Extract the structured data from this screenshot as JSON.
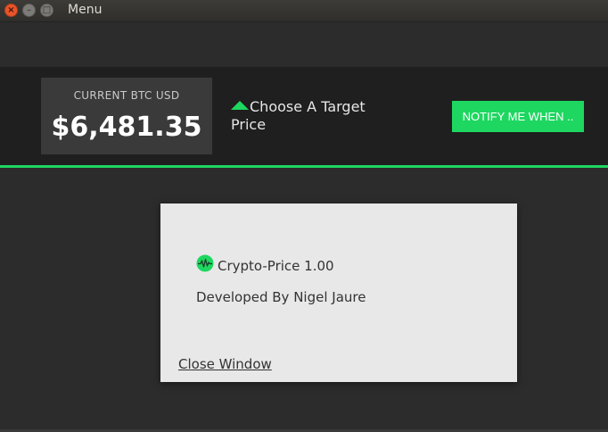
{
  "window": {
    "title": "Menu",
    "close_glyph": "×",
    "min_glyph": "–",
    "max_glyph": "□"
  },
  "header": {
    "price_label": "CURRENT BTC USD",
    "price_value": "$6,481.35",
    "target_text": "Choose A Target Price",
    "notify_button": "NOTIFY ME WHEN .."
  },
  "dialog": {
    "app_name": "Crypto-Price 1.00",
    "developer": "Developed By Nigel Jaure",
    "close_link": "Close Window"
  },
  "colors": {
    "accent": "#1ed760",
    "background": "#2c2c2c",
    "header_bg": "#1f1f1f",
    "dialog_bg": "#e8e8e8"
  },
  "icons": {
    "app": "pulse-icon",
    "target": "triangle-up-icon"
  }
}
